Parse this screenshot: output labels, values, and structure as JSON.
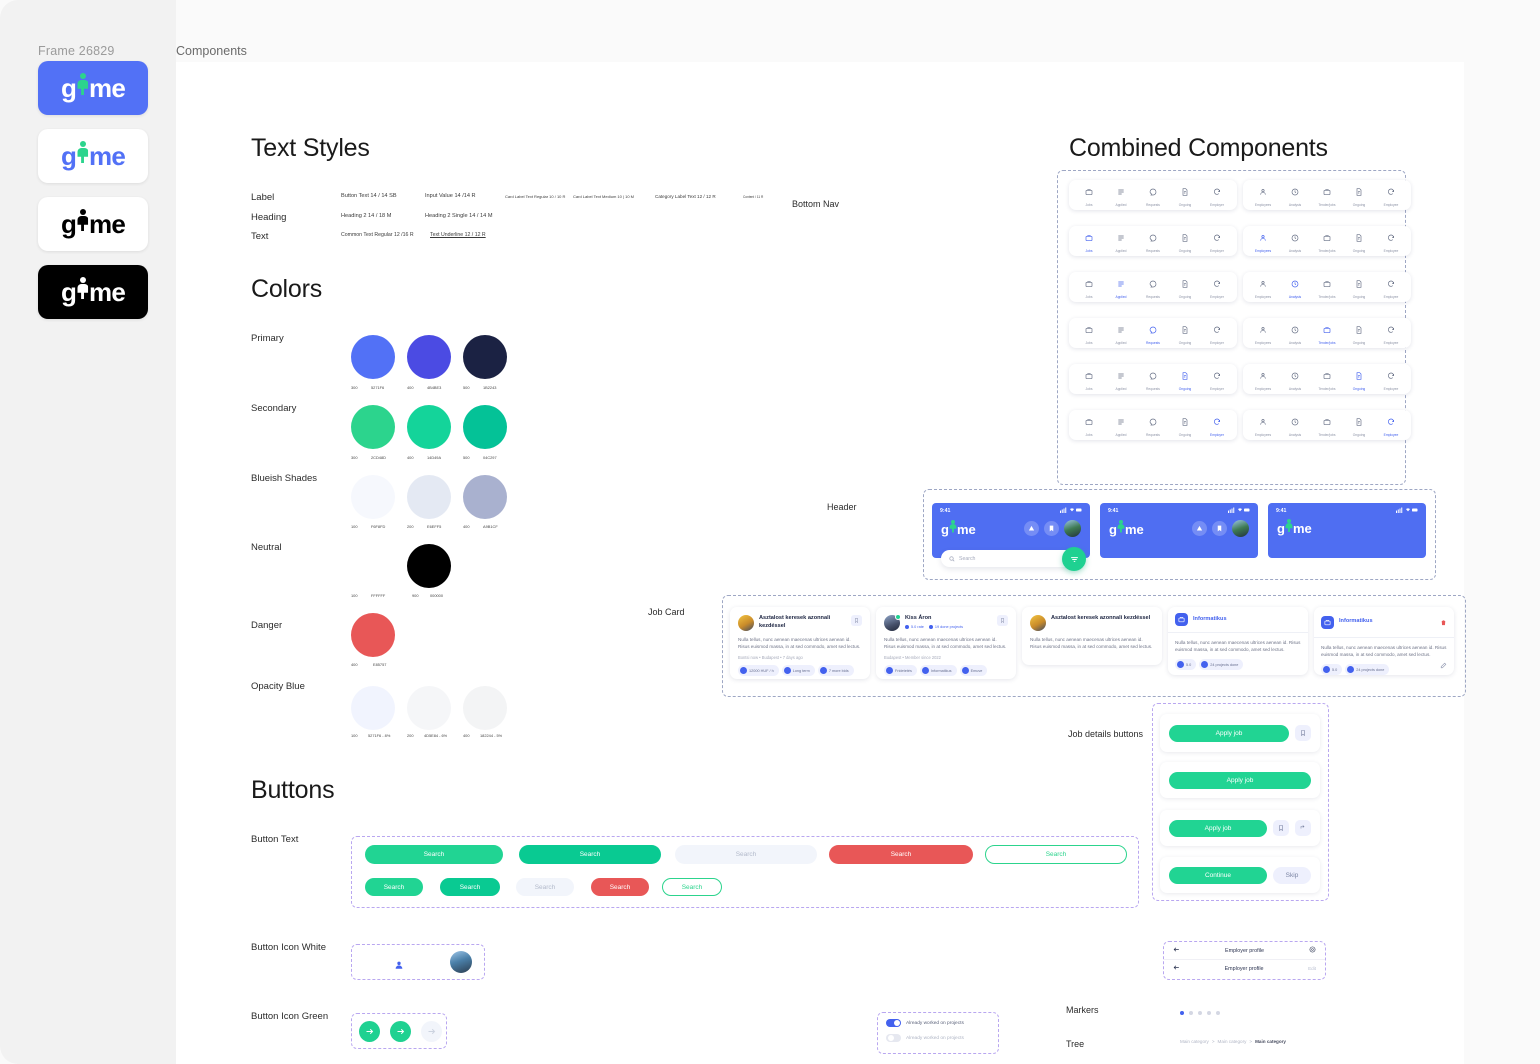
{
  "frame": {
    "title": "Frame 26829",
    "tab": "Components"
  },
  "brand": {
    "name": "gime",
    "variants": [
      "blue-bg",
      "white-bg-color",
      "white-bg-black",
      "black-bg"
    ]
  },
  "sections": {
    "text_styles": "Text Styles",
    "colors": "Colors",
    "buttons": "Buttons",
    "combined": "Combined Components"
  },
  "text_styles": {
    "rows": [
      {
        "label": "Label",
        "samples": [
          "Button Text 14 / 14 SB",
          "Input Value 14 /14 R",
          "Card Label Text Regular 10 / 10 R",
          "Card Label Text Medium 10 | 10 M",
          "Category Label Text 12 / 12 R",
          "Content / 11 R"
        ]
      },
      {
        "label": "Heading",
        "samples": [
          "Heading 2 14 / 18 M",
          "Heading 2 Single 14 / 14 M"
        ]
      },
      {
        "label": "Text",
        "samples": [
          "Common Text Regular 12 /16 R",
          "Text Underline 12 / 12 R"
        ]
      }
    ],
    "bottom_nav_label": "Bottom Nav"
  },
  "colors": {
    "groups": [
      {
        "name": "Primary",
        "swatches": [
          {
            "step": "300",
            "hex": "5271F6",
            "css": "#5271f6"
          },
          {
            "step": "400",
            "hex": "4B4BE3",
            "css": "#4b4be3"
          },
          {
            "step": "500",
            "hex": "1B2243",
            "css": "#1b2243"
          }
        ]
      },
      {
        "name": "Secondary",
        "swatches": [
          {
            "step": "300",
            "hex": "2CD48D",
            "css": "#2cd48d"
          },
          {
            "step": "400",
            "hex": "14D49A",
            "css": "#14d49a"
          },
          {
            "step": "500",
            "hex": "04C297",
            "css": "#04c297"
          }
        ]
      },
      {
        "name": "Blueish Shades",
        "swatches": [
          {
            "step": "100",
            "hex": "F6F8FD",
            "css": "#f6f8fd"
          },
          {
            "step": "200",
            "hex": "E6EFF5",
            "css": "#e4e9f3"
          },
          {
            "step": "400",
            "hex": "A9B1CF",
            "css": "#a9b1cf"
          }
        ]
      },
      {
        "name": "Neutral",
        "swatches": [
          {
            "step": "100",
            "hex": "FFFFFF",
            "css": "#ffffff"
          },
          {
            "step": "900",
            "hex": "000000",
            "css": "#000000"
          }
        ]
      },
      {
        "name": "Danger",
        "swatches": [
          {
            "step": "400",
            "hex": "E85757",
            "css": "#e85757"
          }
        ]
      },
      {
        "name": "Opacity Blue",
        "swatches": [
          {
            "step": "100",
            "hex": "5271F6 - 8%",
            "css": "rgba(82,113,246,.08)"
          },
          {
            "step": "200",
            "hex": "4D5E84 - 6%",
            "css": "rgba(77,94,132,.06)"
          },
          {
            "step": "400",
            "hex": "182244 - 5%",
            "css": "rgba(24,34,68,.05)"
          }
        ]
      }
    ]
  },
  "buttons": {
    "row_label_text": "Button Text",
    "row_label_icon_white": "Button Icon White",
    "row_label_icon_green": "Button Icon Green",
    "search_label": "Search",
    "large": [
      {
        "label": "Search",
        "style": "primary-green"
      },
      {
        "label": "Search",
        "style": "deep-green"
      },
      {
        "label": "Search",
        "style": "ghost"
      },
      {
        "label": "Search",
        "style": "danger"
      },
      {
        "label": "Search",
        "style": "outline"
      }
    ],
    "small": [
      {
        "label": "Search",
        "style": "primary-green"
      },
      {
        "label": "Search",
        "style": "deep-green"
      },
      {
        "label": "Search",
        "style": "ghost"
      },
      {
        "label": "Search",
        "style": "danger"
      },
      {
        "label": "Search",
        "style": "outline"
      }
    ]
  },
  "job_details_buttons": {
    "label": "Job details buttons",
    "rows": [
      {
        "primary": "Apply job",
        "extras": [
          "bookmark-icon"
        ]
      },
      {
        "primary": "Apply job",
        "extras": []
      },
      {
        "primary": "Apply job",
        "extras": [
          "bookmark-icon",
          "share-icon"
        ]
      },
      {
        "primary": "Continue",
        "secondary": "Skip"
      }
    ]
  },
  "header": {
    "label": "Header",
    "time": "9:41",
    "logo": "gime",
    "search_placeholder": "Search"
  },
  "job_card": {
    "label": "Job Card",
    "cards": [
      {
        "title": "Asztalost keresek azonnali kezdéssel",
        "body": "Nulla tellus, nunc aenean maecenas ultrices aenean id. Risus euismod massa, in at sed commodo, amet sed lectus.",
        "meta": "Bontsi now • Budapest • 7 days ago",
        "tags": [
          "12000 HUF / h",
          "Long term",
          "7 more bids"
        ]
      },
      {
        "title": "Kiss Áron",
        "body": "Nulla tellus, nunc aenean maecenas ultrices aenean id. Risus euismod massa, in at sed commodo, amet sed lectus.",
        "meta": "Budapest • Member since 2022",
        "tags": [
          "5.0 rate",
          "19 done projects"
        ],
        "chips": [
          "Fridetetés",
          "Informatikus",
          "Emuve"
        ]
      },
      {
        "title": "Asztalost keresek azonnali kezdéssel",
        "body": "Nulla tellus, nunc aenean maecenas ultrices aenean id. Risus euismod massa, in at sed commodo, amet sed lectus.",
        "meta": "",
        "tags": []
      },
      {
        "title": "Informatikus",
        "body": "Nulla tellus, nunc aenean maecenas ultrices aenean id. Risus euismod massa, in at sed commodo, amet sed lectus.",
        "tags": [
          "5.0",
          "24 projects done"
        ]
      },
      {
        "title": "Informatikus",
        "body": "Nulla tellus, nunc aenean maecenas ultrices aenean id. Risus euismod massa, in at sed commodo, amet sed lectus.",
        "tags": [
          "5.0",
          "24 projects done"
        ]
      }
    ]
  },
  "bottom_nav": {
    "worker_items": [
      "Jobs",
      "Applied",
      "Requests",
      "Ongoing",
      "Employer"
    ],
    "employer_items": [
      "Employees",
      "Analysis",
      "Tender/jobs",
      "Ongoing",
      "Employee"
    ],
    "rows_active": [
      -1,
      0,
      1,
      2,
      3,
      4
    ]
  },
  "employer_profile": {
    "title": "Employer profile",
    "action": "Edit"
  },
  "markers": {
    "label": "Markers",
    "count": 5,
    "active_index": 0
  },
  "tree": {
    "label": "Tree",
    "crumbs": [
      "Main category",
      "Main category",
      "Main category"
    ],
    "separator": ">"
  },
  "toggles": {
    "items": [
      {
        "label": "Already worked on projects",
        "on": true
      },
      {
        "label": "Already worked on projects",
        "on": false
      }
    ]
  }
}
